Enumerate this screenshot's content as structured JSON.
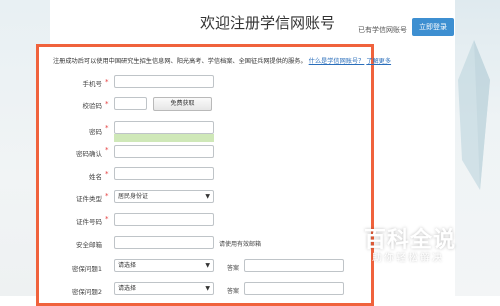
{
  "header": {
    "title": "欢迎注册学信网账号",
    "have_account": "已有学信网账号",
    "login_label": "立即登录"
  },
  "notice": {
    "text": "注册成功后可以使用中国研究生招生信息网、阳光高考、学信档案、全国征兵网提供的服务。",
    "link1": "什么是学信网账号？",
    "link2": "了解更多"
  },
  "form": {
    "phone_label": "手机号",
    "code_label": "校验码",
    "get_code_label": "免费获取",
    "password_label": "密码",
    "password_confirm_label": "密码确认",
    "name_label": "姓名",
    "id_type_label": "证件类型",
    "id_type_value": "居民身份证",
    "id_number_label": "证件号码",
    "email_label": "安全邮箱",
    "email_hint": "请使用有效邮箱",
    "q1_label": "密保问题1",
    "q1_value": "请选择",
    "q2_label": "密保问题2",
    "q2_value": "请选择",
    "answer_label": "答案",
    "required_mark": "*"
  },
  "watermark": {
    "title": "百科全说",
    "subtitle": "助你轻松解决"
  },
  "colors": {
    "accent": "#f0623c",
    "button": "#3d8fd1",
    "link": "#2a6ebb"
  }
}
